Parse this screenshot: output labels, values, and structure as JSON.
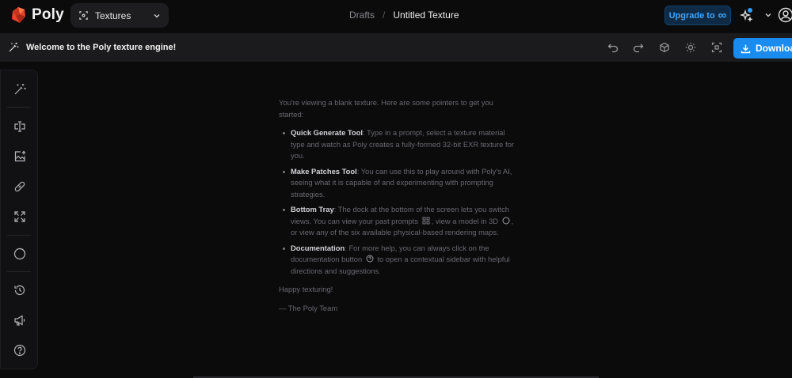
{
  "app": {
    "name": "Poly"
  },
  "header": {
    "project_select": {
      "value": "Textures"
    },
    "breadcrumb": {
      "parent": "Drafts",
      "separator": "/",
      "current": "Untitled Texture"
    },
    "upgrade_label": "Upgrade to",
    "upgrade_symbol": "∞"
  },
  "toolbar": {
    "welcome": "Welcome to the Poly texture engine!",
    "download_label": "Download"
  },
  "sidebar": {
    "items": [
      {
        "icon": "magic-wand-icon"
      },
      {
        "icon": "text-cursor-icon"
      },
      {
        "icon": "image-upload-icon"
      },
      {
        "icon": "bandage-icon"
      },
      {
        "icon": "expand-icon"
      },
      {
        "icon": "circle-half-icon"
      },
      {
        "icon": "history-icon"
      },
      {
        "icon": "megaphone-icon"
      },
      {
        "icon": "help-icon"
      }
    ]
  },
  "content": {
    "intro": "You're viewing a blank texture. Here are some pointers to get you started:",
    "tips": [
      {
        "title": "Quick Generate Tool",
        "text": ": Type in a prompt, select a texture material type and watch as Poly creates a fully-formed 32-bit EXR texture for you."
      },
      {
        "title": "Make Patches Tool",
        "text": ": You can use this to play around with Poly's AI, seeing what it is capable of and experimenting with prompting strategies."
      },
      {
        "title": "Bottom Tray",
        "text_1": ": The dock at the bottom of the screen lets you switch views. You can view your past prompts",
        "text_2": ", view a model in 3D",
        "text_3": ", or view any of the six available physical-based rendering maps."
      },
      {
        "title": "Documentation",
        "text_1": ": For more help, you can always click on the documentation button",
        "text_2": " to open a contextual sidebar with helpful directions and suggestions."
      }
    ],
    "closing": "Happy texturing!",
    "signature": "— The Poly Team"
  },
  "colors": {
    "accent": "#1a8cf0",
    "upgrade_text": "#3da7ff",
    "logo_red": "#e8442a"
  }
}
